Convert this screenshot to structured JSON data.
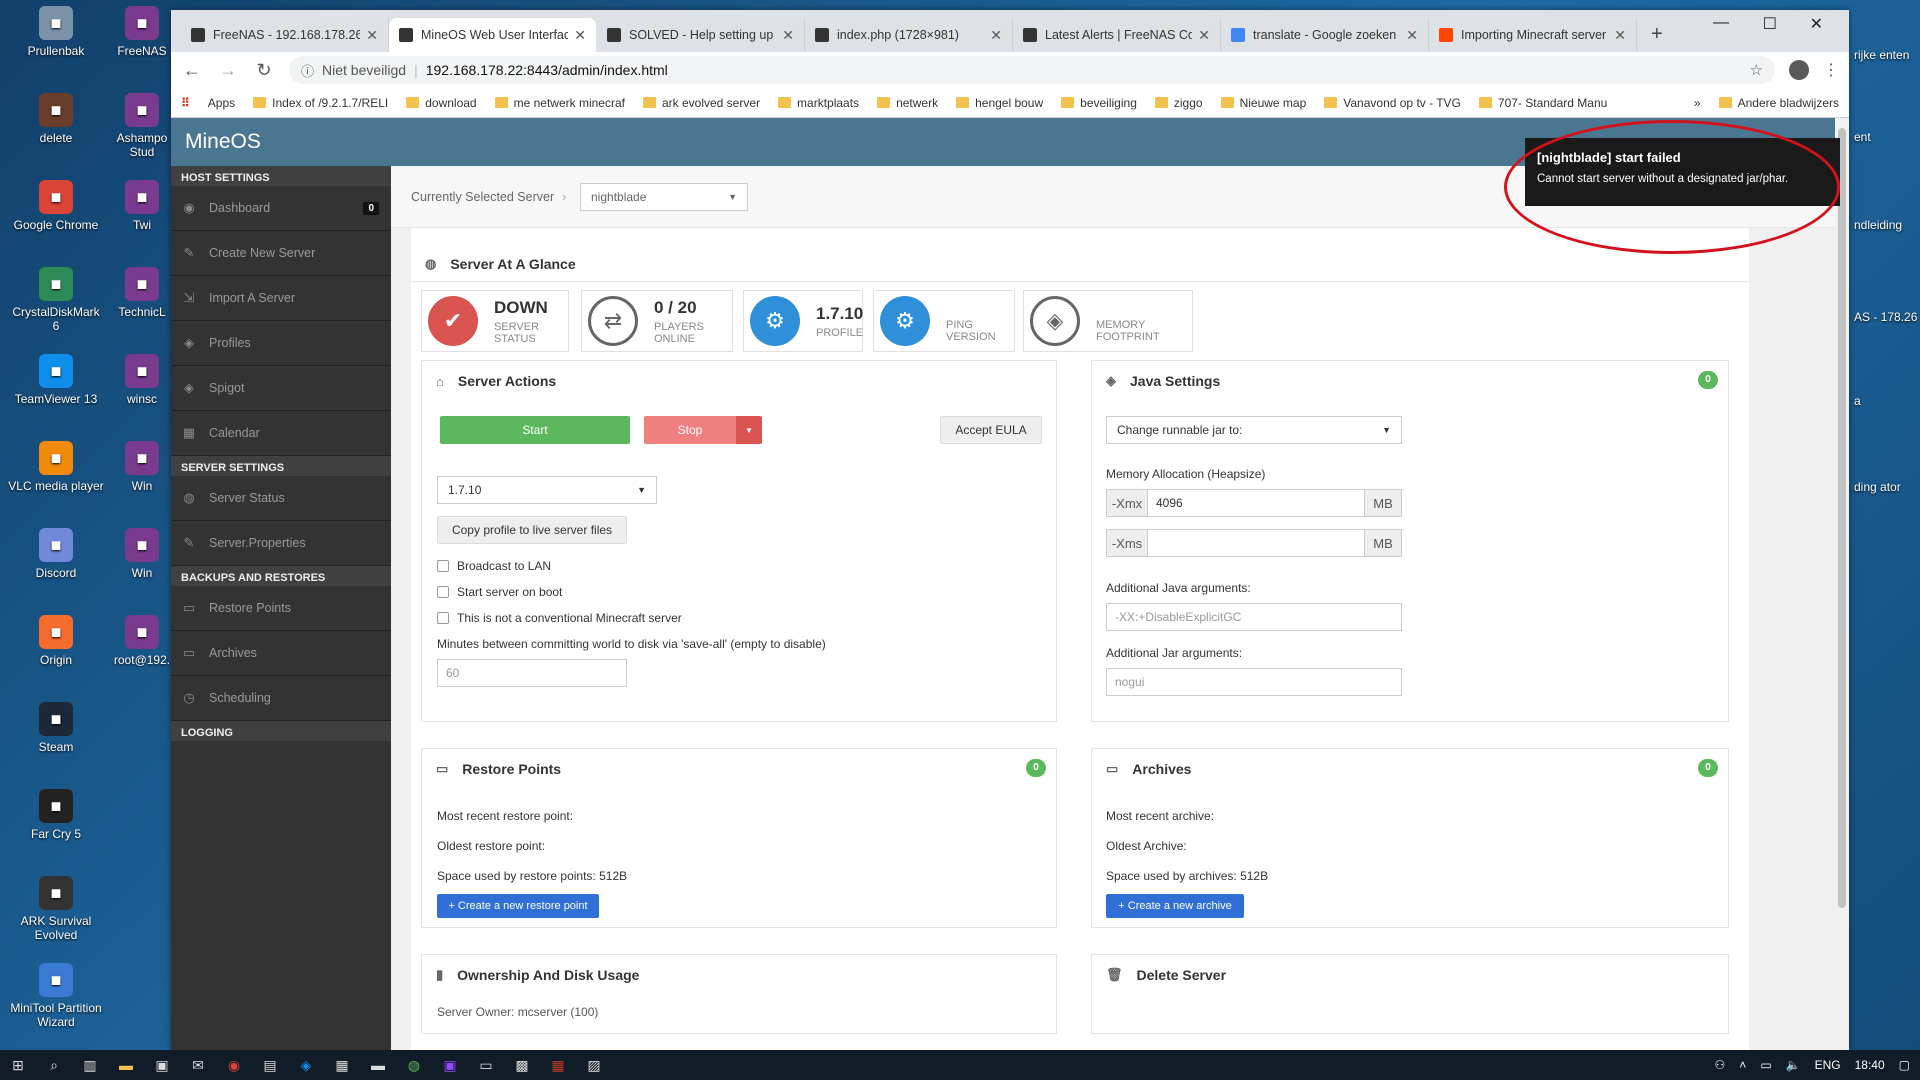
{
  "desktop": {
    "icons": [
      {
        "label": "Prullenbak",
        "icon": "recycle-bin-icon",
        "color": "#7a93a8"
      },
      {
        "label": "delete",
        "icon": "delete-icon",
        "color": "#6a3d2b"
      },
      {
        "label": "Google Chrome",
        "icon": "chrome-icon",
        "color": "#db4437"
      },
      {
        "label": "CrystalDiskMark 6",
        "icon": "crystaldiskmark-icon",
        "color": "#2e8b57"
      },
      {
        "label": "TeamViewer 13",
        "icon": "teamviewer-icon",
        "color": "#0e8ee9"
      },
      {
        "label": "VLC media player",
        "icon": "vlc-icon",
        "color": "#f28a0c"
      },
      {
        "label": "Discord",
        "icon": "discord-icon",
        "color": "#7289da"
      },
      {
        "label": "Origin",
        "icon": "origin-icon",
        "color": "#f56c2d"
      },
      {
        "label": "Steam",
        "icon": "steam-icon",
        "color": "#1b2838"
      },
      {
        "label": "Far Cry 5",
        "icon": "farcry-icon",
        "color": "#222222"
      },
      {
        "label": "ARK Survival Evolved",
        "icon": "ark-icon",
        "color": "#333333"
      },
      {
        "label": "MiniTool Partition Wizard",
        "icon": "minitool-icon",
        "color": "#3a7bd5"
      }
    ],
    "icons_col2": [
      {
        "label": "FreeNAS",
        "icon": "winrar-icon"
      },
      {
        "label": "Ashampo Stud",
        "icon": "ashampoo-icon"
      },
      {
        "label": "Twi",
        "icon": "twitch-icon"
      },
      {
        "label": "TechnicL",
        "icon": "technic-icon"
      },
      {
        "label": "winsc",
        "icon": "winscp-icon"
      },
      {
        "label": "Win",
        "icon": "win-icon"
      },
      {
        "label": "Win",
        "icon": "win2-icon"
      },
      {
        "label": "root@192.",
        "icon": "putty-icon"
      }
    ],
    "right_fragments": [
      "rijke enten",
      "ent",
      "ndleiding",
      "AS - 178.26",
      "a",
      "ding ator"
    ]
  },
  "browser": {
    "tabs": [
      {
        "title": "FreeNAS - 192.168.178.26",
        "fav_color": "#333333"
      },
      {
        "title": "MineOS Web User Interface",
        "fav_color": "#333333",
        "active": true
      },
      {
        "title": "SOLVED - Help setting up",
        "fav_color": "#333333"
      },
      {
        "title": "index.php (1728×981)",
        "fav_color": "#333333"
      },
      {
        "title": "Latest Alerts | FreeNAS Co",
        "fav_color": "#333333"
      },
      {
        "title": "translate - Google zoeken",
        "fav_color": "#4285f4"
      },
      {
        "title": "Importing Minecraft server",
        "fav_color": "#ff4500"
      }
    ],
    "new_tab": "+",
    "window_controls": {
      "minimize": "—",
      "maximize": "☐",
      "close": "✕"
    },
    "address": {
      "security": "Niet beveiligd",
      "url": "192.168.178.22:8443/admin/index.html"
    },
    "bookmarks": [
      "Apps",
      "Index of /9.2.1.7/RELI",
      "download",
      "me netwerk minecraf",
      "ark evolved server",
      "marktplaats",
      "netwerk",
      "hengel bouw",
      "beveiliging",
      "ziggo",
      "Nieuwe map",
      "Vanavond op tv - TVG",
      "707- Standard Manu"
    ],
    "bookmarks_more": "»",
    "bookmarks_other": "Andere bladwijzers"
  },
  "app": {
    "brand": "MineOS",
    "sidebar": {
      "host_header": "HOST SETTINGS",
      "host_items": [
        {
          "label": "Dashboard",
          "icon": "dashboard-icon",
          "glyph": "◉",
          "badge": "0"
        },
        {
          "label": "Create New Server",
          "icon": "edit-icon",
          "glyph": "✎"
        },
        {
          "label": "Import A Server",
          "icon": "import-icon",
          "glyph": "⇲"
        },
        {
          "label": "Profiles",
          "icon": "tag-icon",
          "glyph": "◈"
        },
        {
          "label": "Spigot",
          "icon": "tag-icon",
          "glyph": "◈"
        },
        {
          "label": "Calendar",
          "icon": "calendar-icon",
          "glyph": "▦"
        }
      ],
      "server_header": "SERVER SETTINGS",
      "server_items": [
        {
          "label": "Server Status",
          "icon": "globe-icon",
          "glyph": "◍"
        },
        {
          "label": "Server.Properties",
          "icon": "edit-icon",
          "glyph": "✎"
        }
      ],
      "backup_header": "BACKUPS AND RESTORES",
      "backup_items": [
        {
          "label": "Restore Points",
          "icon": "hdd-icon",
          "glyph": "▭"
        },
        {
          "label": "Archives",
          "icon": "hdd-icon",
          "glyph": "▭"
        },
        {
          "label": "Scheduling",
          "icon": "clock-icon",
          "glyph": "◷"
        }
      ],
      "logging_header": "LOGGING"
    },
    "selected_label": "Currently Selected Server",
    "selected_server": "nightblade",
    "glance": {
      "title": "Server At A Glance",
      "tiles": [
        {
          "big": "DOWN",
          "small": "SERVER STATUS",
          "color": "#d9534f",
          "glyph": "✔"
        },
        {
          "big": "0 / 20",
          "small": "PLAYERS ONLINE",
          "color": "#ffffff",
          "glyph": "⇄"
        },
        {
          "big": "1.7.10",
          "small": "PROFILE",
          "color": "#2f8fd9",
          "glyph": "⚙"
        },
        {
          "big": "",
          "small": "PING VERSION",
          "color": "#2f8fd9",
          "glyph": "⚙"
        },
        {
          "big": "",
          "small": "MEMORY FOOTPRINT",
          "color": "#ffffff",
          "glyph": "◈"
        }
      ]
    },
    "actions": {
      "title": "Server Actions",
      "start": "Start",
      "stop": "Stop",
      "eula": "Accept EULA",
      "profile_select": "1.7.10",
      "copy_profile": "Copy profile to live server files",
      "checkboxes": [
        "Broadcast to LAN",
        "Start server on boot",
        "This is not a conventional Minecraft server"
      ],
      "commit_label": "Minutes between committing world to disk via 'save-all' (empty to disable)",
      "commit_placeholder": "60"
    },
    "java": {
      "title": "Java Settings",
      "badge": "0",
      "jar_select": "Change runnable jar to:",
      "memory_label": "Memory Allocation (Heapsize)",
      "xmx_label": "-Xmx",
      "xmx_value": "4096",
      "xms_label": "-Xms",
      "xms_value": "",
      "unit": "MB",
      "java_args_label": "Additional Java arguments:",
      "java_args_placeholder": "-XX:+DisableExplicitGC",
      "jar_args_label": "Additional Jar arguments:",
      "jar_args_placeholder": "nogui"
    },
    "restore": {
      "title": "Restore Points",
      "badge": "0",
      "recent": "Most recent restore point:",
      "oldest": "Oldest restore point:",
      "space": "Space used by restore points: 512B",
      "button": "+ Create a new restore point"
    },
    "archives": {
      "title": "Archives",
      "badge": "0",
      "recent": "Most recent archive:",
      "oldest": "Oldest Archive:",
      "space": "Space used by archives: 512B",
      "button": "+ Create a new archive"
    },
    "ownership": {
      "title": "Ownership And Disk Usage",
      "owner_partial": "Server Owner: mcserver (100)"
    },
    "delete": {
      "title": "Delete Server"
    },
    "toast": {
      "title": "[nightblade] start failed",
      "body": "Cannot start server without a designated jar/phar."
    }
  },
  "taskbar": {
    "language": "ENG",
    "time": "18:40"
  },
  "colors": {
    "start_green": "#5cb85c",
    "stop_red": "#f08080",
    "stop_dropdown": "#d9534f",
    "primary_blue": "#2f6fd6",
    "topnav": "#4a7691",
    "toast_ring": "#d3131b"
  }
}
